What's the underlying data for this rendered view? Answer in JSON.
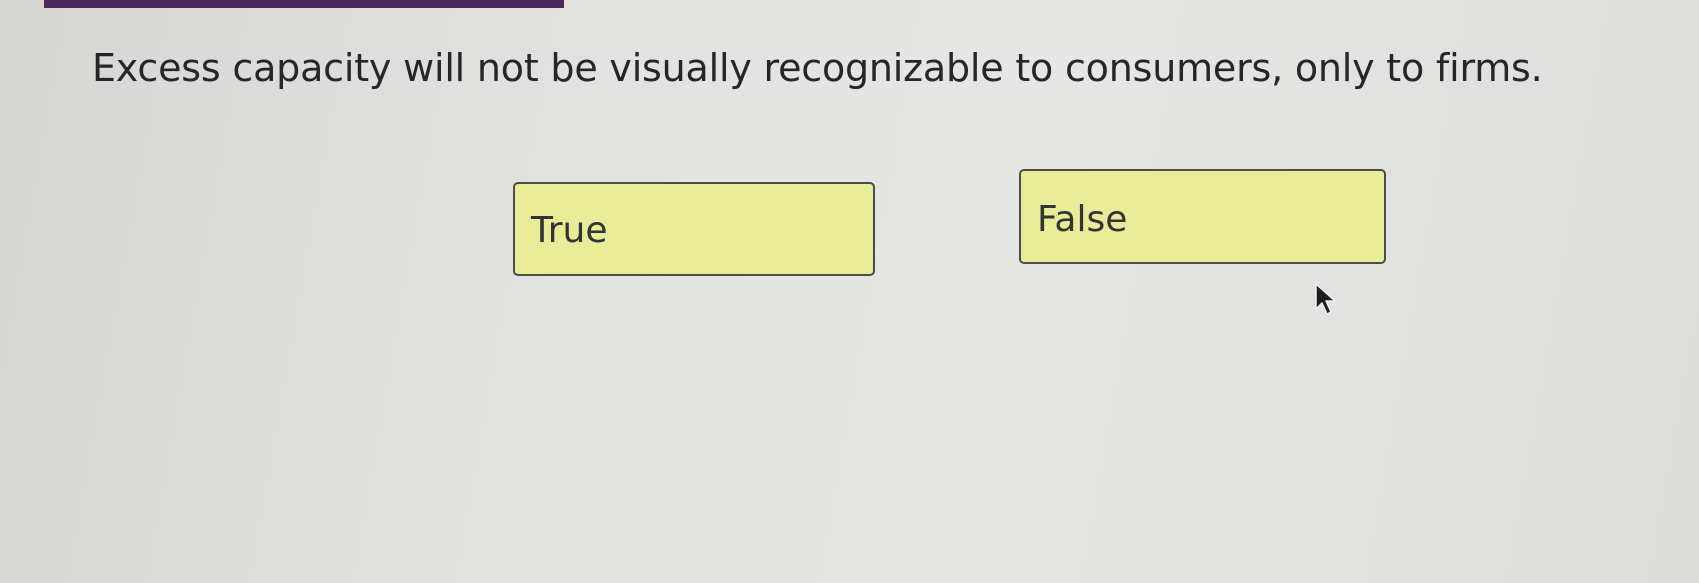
{
  "question": {
    "text": "Excess capacity will not be visually recognizable to consumers, only to firms."
  },
  "options": {
    "true_label": "True",
    "false_label": "False"
  },
  "colors": {
    "top_bar": "#4a2a5c",
    "option_fill": "#e8eb98",
    "option_border": "#4c4c47",
    "text": "#262626"
  },
  "icons": {
    "cursor": "mouse-pointer-icon"
  }
}
